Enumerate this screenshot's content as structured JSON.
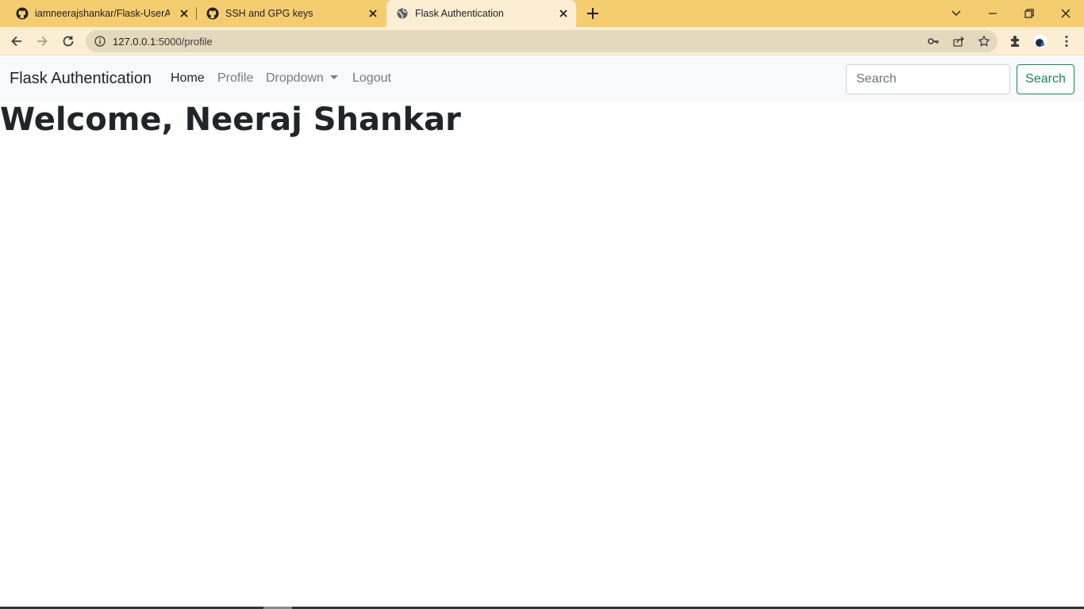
{
  "browser": {
    "tabs": [
      {
        "title": "iamneerajshankar/Flask-UserAuth",
        "icon": "github-icon"
      },
      {
        "title": "SSH and GPG keys",
        "icon": "github-icon"
      },
      {
        "title": "Flask Authentication",
        "icon": "globe-icon"
      }
    ],
    "url_host": "127.0.0.1",
    "url_rest": ":5000/profile"
  },
  "navbar": {
    "brand": "Flask Authentication",
    "links": [
      "Home",
      "Profile",
      "Dropdown",
      "Logout"
    ],
    "search_placeholder": "Search",
    "search_button": "Search"
  },
  "page": {
    "heading": "Welcome, Neeraj Shankar"
  },
  "colors": {
    "tabstrip": "#f5cd71",
    "toolbar": "#fbeed3",
    "accent_green": "#198754"
  }
}
